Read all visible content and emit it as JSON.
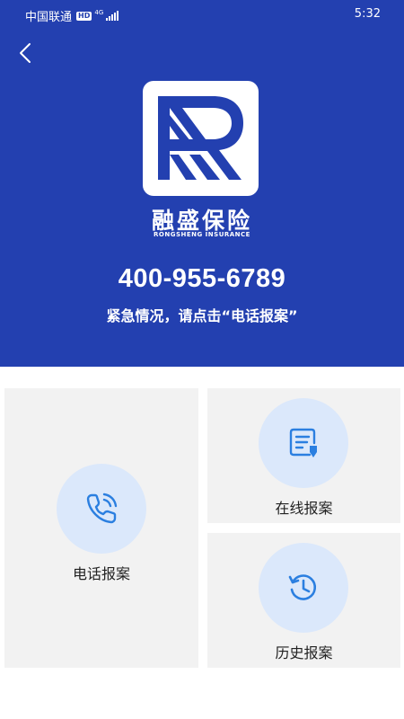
{
  "status_bar": {
    "carrier": "中国联通",
    "hd_badge": "HD",
    "network": "4G",
    "time": "5:32"
  },
  "header": {
    "back_icon": "chevron-left-icon"
  },
  "brand": {
    "name": "融盛保险",
    "name_en": "RONGSHENG INSURANCE",
    "logo_letter": "R"
  },
  "hotline": {
    "number": "400-955-6789",
    "hint": "紧急情况，请点击“电话报案”"
  },
  "actions": {
    "phone_report": {
      "label": "电话报案",
      "icon": "phone-icon"
    },
    "online_report": {
      "label": "在线报案",
      "icon": "report-form-icon"
    },
    "history_report": {
      "label": "历史报案",
      "icon": "history-icon"
    }
  },
  "colors": {
    "primary": "#2340b0",
    "icon_blue": "#2b7fe0",
    "icon_circle_bg": "#dbe8fb",
    "card_bg": "#f2f2f2"
  }
}
